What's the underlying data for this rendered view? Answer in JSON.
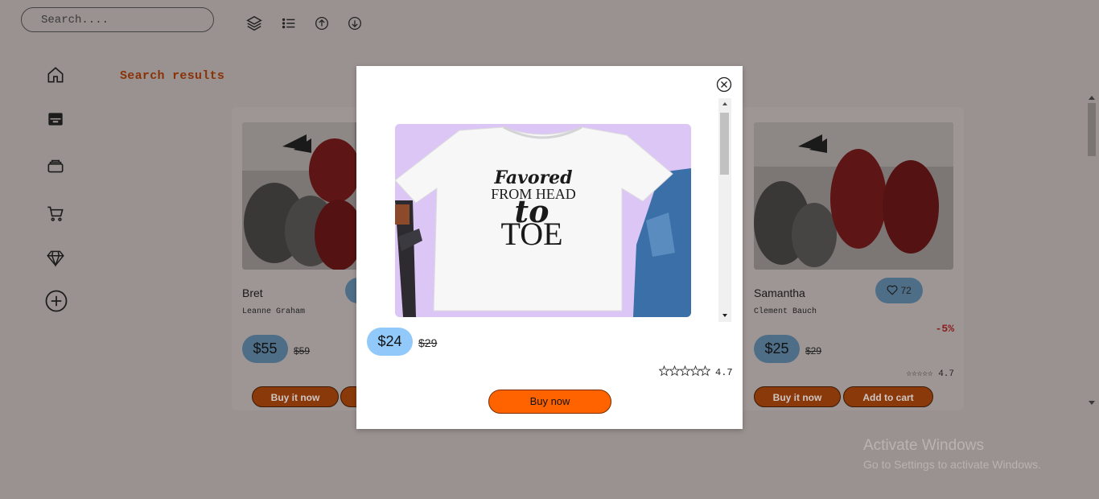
{
  "search": {
    "placeholder": "Search...."
  },
  "toolbar": {
    "icons": [
      "layers-icon",
      "list-icon",
      "arrow-up-circle-icon",
      "arrow-down-circle-icon"
    ]
  },
  "sidebar": {
    "icons": [
      "home-icon",
      "storefront-icon",
      "archive-icon",
      "cart-icon",
      "diamond-icon",
      "add-circle-icon"
    ]
  },
  "main": {
    "title": "Search results"
  },
  "cards": [
    {
      "name": "Bret",
      "author": "Leanne Graham",
      "price": "$55",
      "old_price": "$59",
      "buy_label": "Buy it now"
    },
    {
      "name": "Samantha",
      "author": "Clement Bauch",
      "price": "$25",
      "old_price": "$29",
      "likes": "72",
      "discount": "-5%",
      "rating": "4.7",
      "buy_label": "Buy it now",
      "cart_label": "Add to cart"
    }
  ],
  "modal": {
    "image_text": [
      "Favored",
      "FROM HEAD",
      "to",
      "TOE"
    ],
    "price": "$24",
    "old_price": "$29",
    "rating": "4.7",
    "buy_label": "Buy now"
  },
  "watermark": {
    "title": "Activate Windows",
    "subtitle": "Go to Settings to activate Windows."
  },
  "colors": {
    "accent": "#ff6300",
    "price_badge": "#90c9fa",
    "title": "#8a3208",
    "overlay_bg": "#9a9290"
  }
}
